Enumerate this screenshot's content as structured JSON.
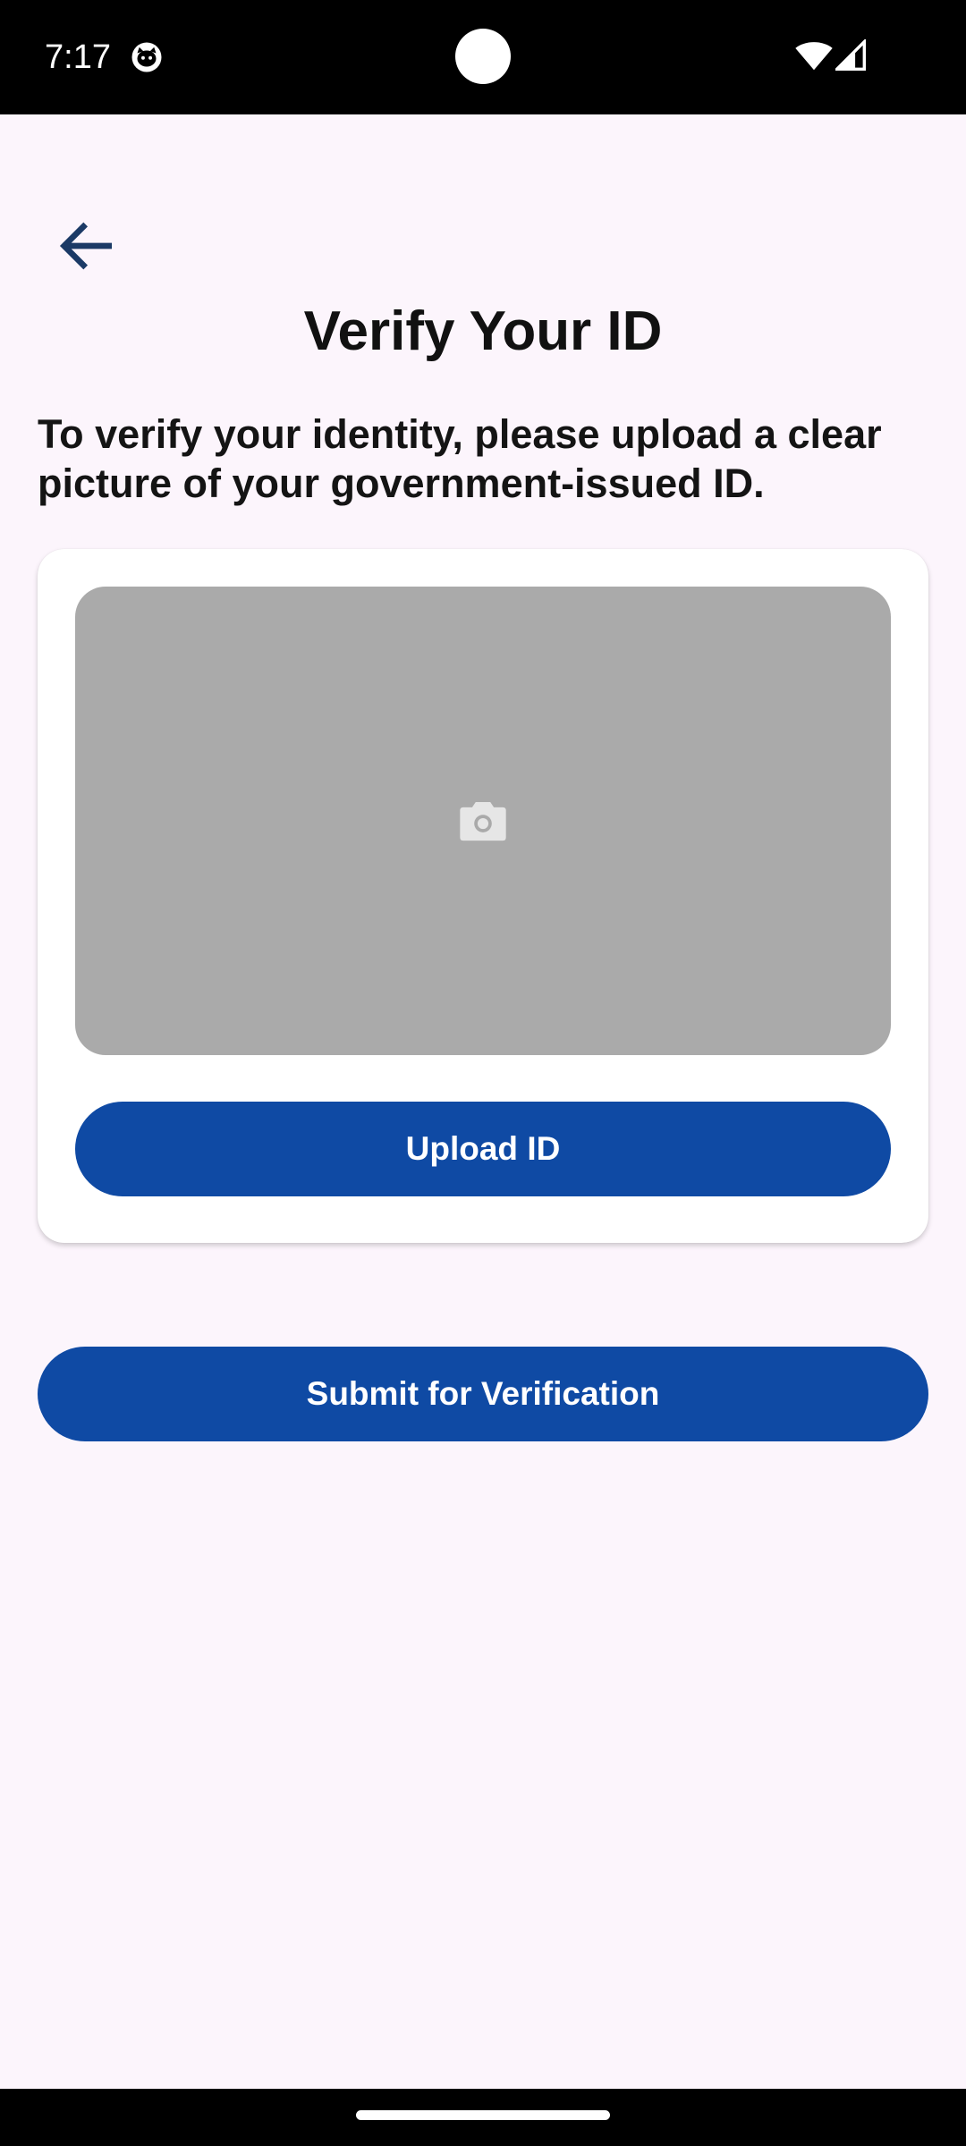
{
  "status_bar": {
    "time": "7:17",
    "app_icon": "cat-face-icon",
    "wifi_icon": "wifi-icon",
    "signal_icon": "cellular-signal-icon"
  },
  "header": {
    "back_icon": "arrow-back-icon",
    "title": "Verify Your ID"
  },
  "main": {
    "instructions": "To verify your identity, please upload a clear picture of your government-issued ID.",
    "upload_card": {
      "preview_icon": "camera-icon",
      "upload_label": "Upload ID"
    },
    "submit_label": "Submit for Verification"
  },
  "colors": {
    "accent": "#0f4aa4",
    "background": "#fcf5fc",
    "preview_placeholder": "#aaaaaa",
    "back_arrow": "#1b3a66"
  }
}
